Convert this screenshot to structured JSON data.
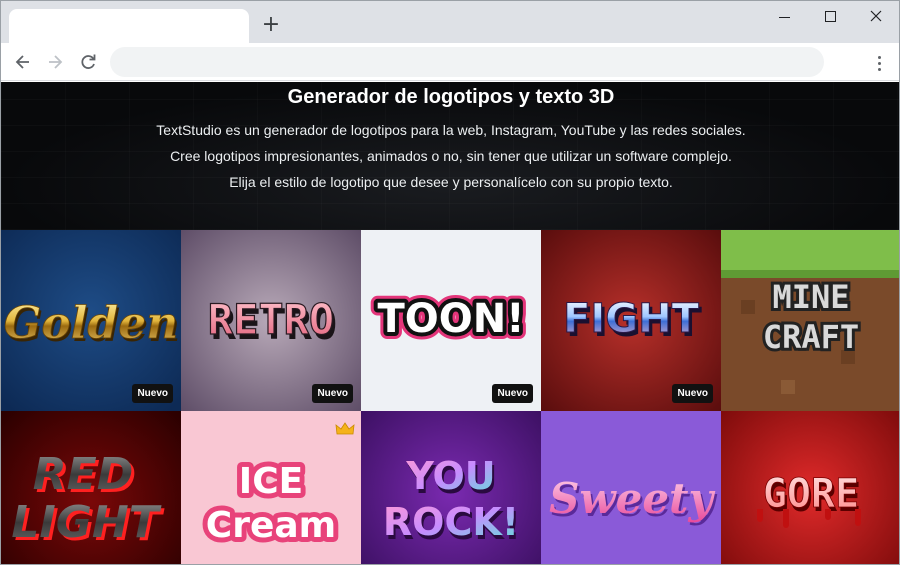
{
  "browser": {
    "new_tab_label": "+",
    "url": ""
  },
  "hero": {
    "title": "Generador de logotipos y texto 3D",
    "line1": "TextStudio es un generador de logotipos para la web, Instagram, YouTube y las redes sociales.",
    "line2": "Cree logotipos impresionantes, animados o no, sin tener que utilizar un software complejo.",
    "line3": "Elija el estilo de logotipo que desee y personalícelo con su propio texto."
  },
  "tiles": [
    {
      "text": "Golden",
      "badge": "Nuevo",
      "bg": "#123466"
    },
    {
      "text": "RETRO",
      "badge": "Nuevo",
      "bg": "#8a7890"
    },
    {
      "text": "TOON!",
      "badge": "Nuevo",
      "bg": "#eef1f5"
    },
    {
      "text": "FIGHT",
      "badge": "Nuevo",
      "bg": "#8e1c1c"
    },
    {
      "line1": "MINE",
      "line2": "CRAFT",
      "bg": "#7a4a2a"
    },
    {
      "line1": "RED",
      "line2": "LIGHT",
      "bg": "#5a0000"
    },
    {
      "line1": "ICE",
      "line2": "Cream",
      "premium_icon": "crown-icon",
      "bg": "#f9c7d3"
    },
    {
      "line1": "YOU",
      "line2": "ROCK!",
      "bg": "#5a1a86"
    },
    {
      "text": "Sweety",
      "bg": "#8a5ad8"
    },
    {
      "text": "GORE",
      "bg": "#c0151a"
    }
  ]
}
